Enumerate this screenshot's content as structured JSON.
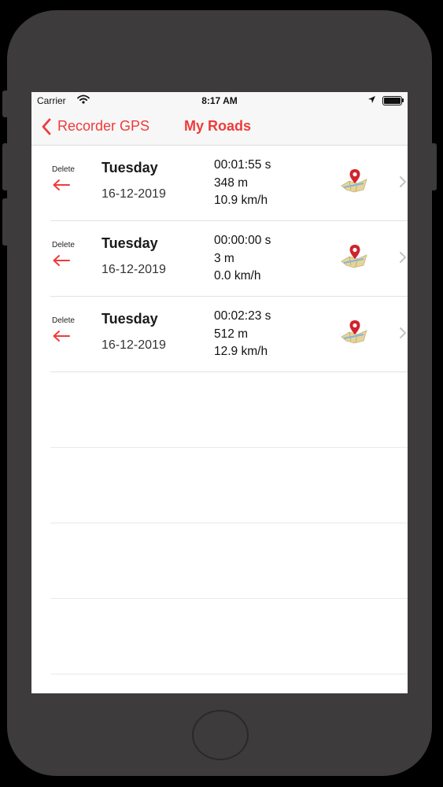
{
  "status_bar": {
    "carrier": "Carrier",
    "time": "8:17 AM"
  },
  "nav": {
    "back_label": "Recorder GPS",
    "title": "My Roads"
  },
  "colors": {
    "accent": "#ef3b3b",
    "device": "#3d3b3c"
  },
  "icons": {
    "back": "chevron-left-icon",
    "delete": "arrow-left-icon",
    "map": "map-pin-icon",
    "disclosure": "chevron-right-icon"
  },
  "roads": [
    {
      "delete_label": "Delete",
      "day": "Tuesday",
      "date": "16-12-2019",
      "duration": "00:01:55 s",
      "distance": "348 m",
      "speed": "10.9 km/h"
    },
    {
      "delete_label": "Delete",
      "day": "Tuesday",
      "date": "16-12-2019",
      "duration": "00:00:00 s",
      "distance": "3 m",
      "speed": "0.0 km/h"
    },
    {
      "delete_label": "Delete",
      "day": "Tuesday",
      "date": "16-12-2019",
      "duration": "00:02:23 s",
      "distance": "512 m",
      "speed": "12.9 km/h"
    }
  ]
}
